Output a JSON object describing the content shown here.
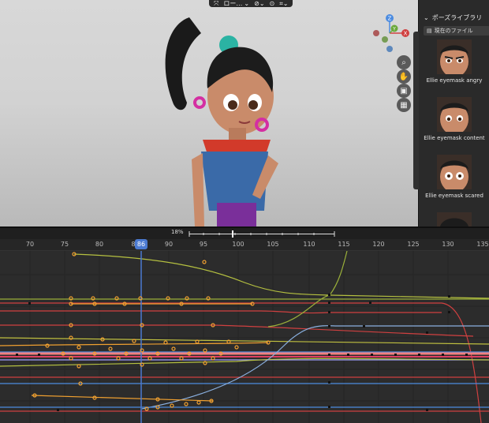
{
  "header": {
    "mode_label": "ロー…",
    "icons": [
      "transform-icon",
      "chevron-down-icon",
      "link-icon",
      "overlay-icon",
      "gizmo-icon"
    ]
  },
  "gizmo": {
    "z": "Z",
    "y": "Y",
    "x": "X"
  },
  "sidebar": {
    "title": "ポーズライブラリ",
    "filter_label": "現在のファイル",
    "poses": [
      {
        "label": "Ellie eyemask angry"
      },
      {
        "label": "Ellie eyemask content"
      },
      {
        "label": "Ellie eyemask scared"
      }
    ]
  },
  "timeline": {
    "zoom_percent": "18%",
    "current_frame": "86",
    "frame_ticks": [
      "70",
      "75",
      "80",
      "8",
      "90",
      "95",
      "100",
      "105",
      "110",
      "115",
      "120",
      "125",
      "130",
      "135"
    ]
  },
  "colors": {
    "accent": "#4b7ad1",
    "keyframe": "#f0a030"
  }
}
